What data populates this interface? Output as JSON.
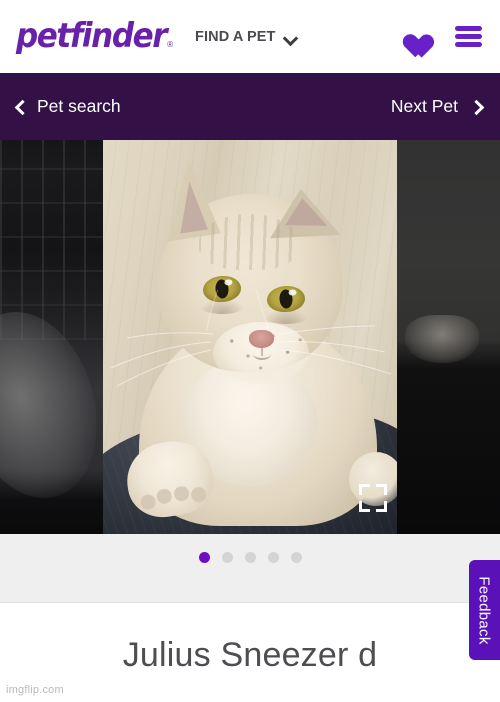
{
  "header": {
    "logo_text": "petfinder",
    "logo_mark": "®",
    "find_a_pet_label": "FIND A PET",
    "dropdown_icon": "chevron-down-icon",
    "favorites_icon": "heart-icon",
    "menu_icon": "hamburger-menu-icon"
  },
  "petnav": {
    "back_label": "Pet search",
    "back_icon": "chevron-left-icon",
    "next_label": "Next Pet",
    "next_icon": "chevron-right-icon",
    "background_color": "#331147"
  },
  "carousel": {
    "expand_icon": "fullscreen-expand-icon",
    "total_slides": 5,
    "active_slide": 1,
    "dots": [
      {
        "index": 1,
        "active": true
      },
      {
        "index": 2,
        "active": false
      },
      {
        "index": 3,
        "active": false
      },
      {
        "index": 4,
        "active": false
      },
      {
        "index": 5,
        "active": false
      }
    ],
    "active_dot_color": "#6a10c0",
    "inactive_dot_color": "#d4d4d6"
  },
  "detail": {
    "pet_name": "Julius Sneezer d"
  },
  "feedback": {
    "label": "Feedback",
    "background_color": "#5b11b8"
  },
  "watermark": {
    "text": "imgflip.com"
  },
  "colors": {
    "brand_purple": "#6821c8",
    "nav_dark_purple": "#331147",
    "strip_gray": "#efeff0"
  }
}
